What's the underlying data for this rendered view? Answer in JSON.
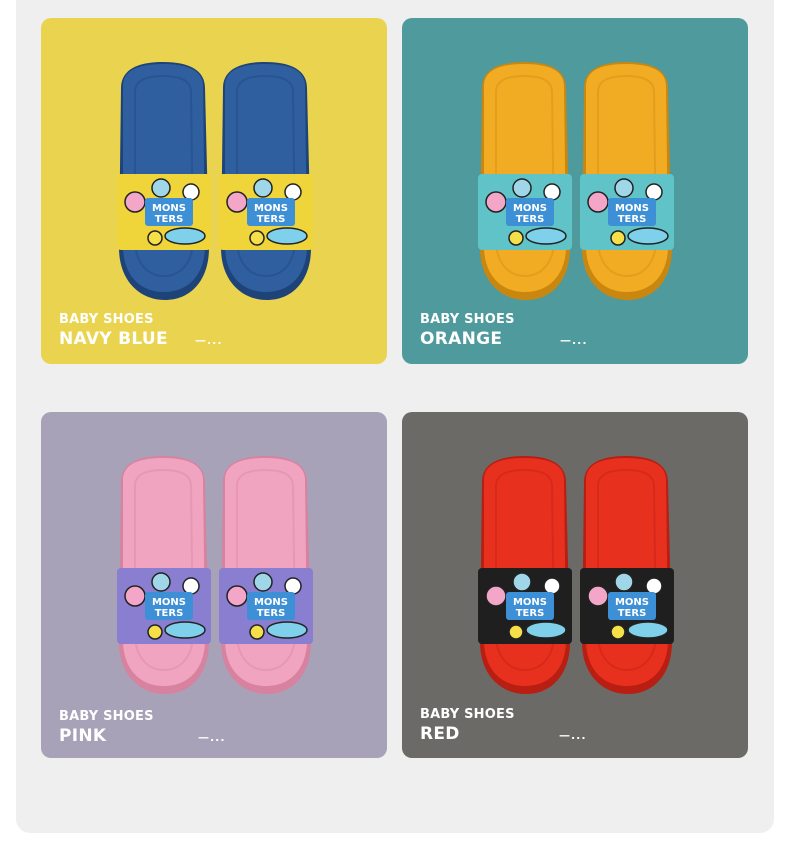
{
  "products": [
    {
      "subtitle": "BABY SHOES",
      "color_name": "NAVY BLUE",
      "more": "—...",
      "bg": "#ead44f",
      "sole": "#2f5f9f",
      "sole_dark": "#1e4378",
      "strap_bg": "#f0d53a",
      "strap_text": "MONS TERS"
    },
    {
      "subtitle": "BABY SHOES",
      "color_name": "ORANGE",
      "more": "—...",
      "bg": "#4e9a9c",
      "sole": "#f2ac23",
      "sole_dark": "#c98710",
      "strap_bg": "#5fc3c8",
      "strap_text": "MONS TERS"
    },
    {
      "subtitle": "BABY SHOES",
      "color_name": "PINK",
      "more": "—...",
      "bg": "#a7a2b8",
      "sole": "#f0a4c0",
      "sole_dark": "#d7829f",
      "strap_bg": "#8a7ed0",
      "strap_text": "MONS TERS"
    },
    {
      "subtitle": "BABY SHOES",
      "color_name": "RED",
      "more": "—...",
      "bg": "#6b6a66",
      "sole": "#e8301f",
      "sole_dark": "#b81e12",
      "strap_bg": "#1f1f1f",
      "strap_text": "MONS TERS"
    }
  ]
}
